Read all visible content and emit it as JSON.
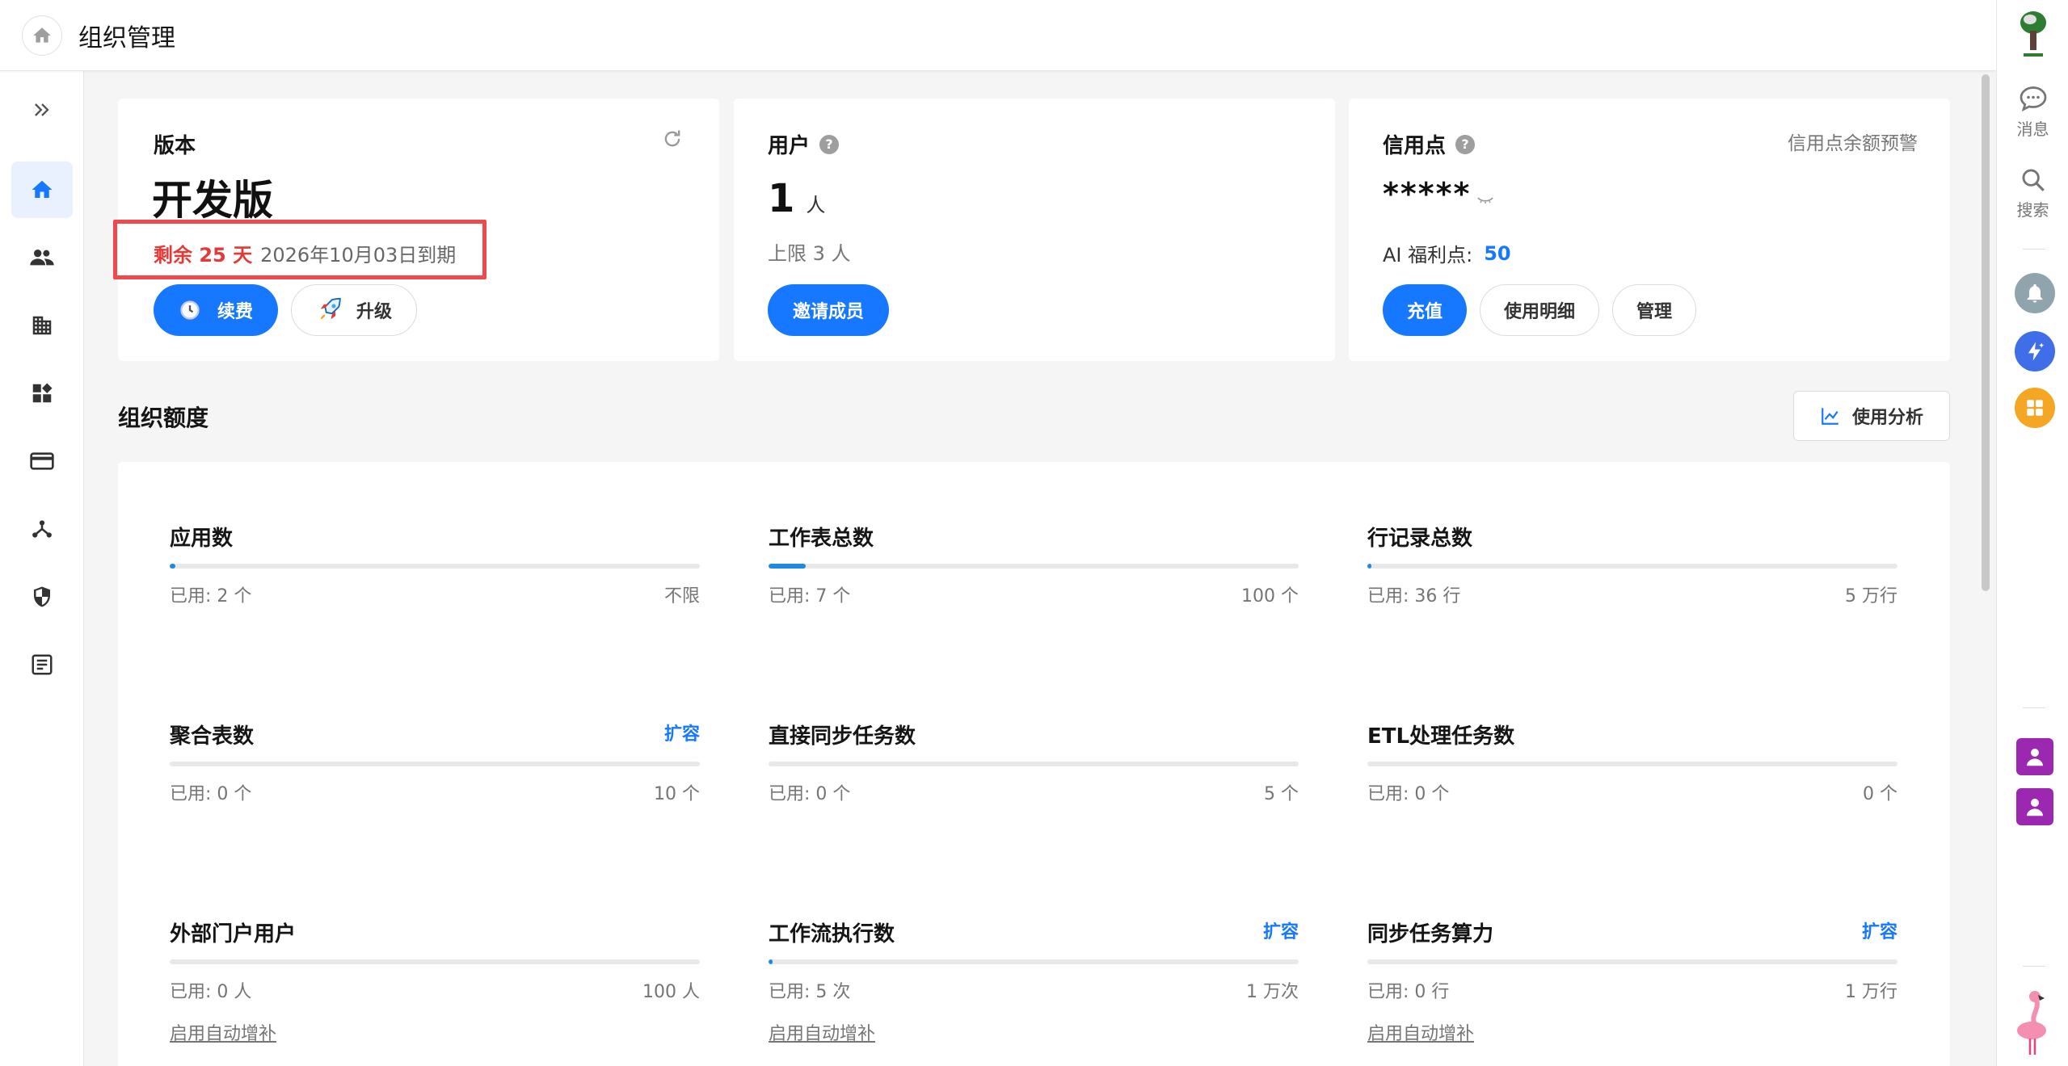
{
  "header": {
    "title": "组织管理"
  },
  "right_rail": {
    "messages_label": "消息",
    "search_label": "搜索"
  },
  "edition": {
    "title": "版本",
    "name": "开发版",
    "remaining": "剩余 25 天",
    "expire": "2026年10月03日到期",
    "renew_label": "续费",
    "upgrade_label": "升级"
  },
  "users": {
    "title": "用户",
    "count": "1",
    "unit": "人",
    "limit": "上限 3 人",
    "invite_label": "邀请成员"
  },
  "credits": {
    "title": "信用点",
    "alert_link": "信用点余额预警",
    "masked_value": "*****",
    "ai_label": "AI 福利点:",
    "ai_value": "50",
    "recharge_label": "充值",
    "details_label": "使用明细",
    "manage_label": "管理"
  },
  "quota_section": {
    "title": "组织额度",
    "analysis_label": "使用分析"
  },
  "quotas": [
    {
      "name": "应用数",
      "used": "已用: 2 个",
      "limit": "不限",
      "expand": "",
      "auto": "",
      "fill": 0.01
    },
    {
      "name": "工作表总数",
      "used": "已用: 7 个",
      "limit": "100 个",
      "expand": "",
      "auto": "",
      "fill": 0.07
    },
    {
      "name": "行记录总数",
      "used": "已用: 36 行",
      "limit": "5 万行",
      "expand": "",
      "auto": "",
      "fill": 0.001
    },
    {
      "name": "聚合表数",
      "used": "已用: 0 个",
      "limit": "10 个",
      "expand": "扩容",
      "auto": "",
      "fill": 0
    },
    {
      "name": "直接同步任务数",
      "used": "已用: 0 个",
      "limit": "5 个",
      "expand": "",
      "auto": "",
      "fill": 0
    },
    {
      "name": "ETL处理任务数",
      "used": "已用: 0 个",
      "limit": "0 个",
      "expand": "",
      "auto": "",
      "fill": 0
    },
    {
      "name": "外部门户用户",
      "used": "已用: 0 人",
      "limit": "100 人",
      "expand": "",
      "auto": "启用自动增补",
      "fill": 0
    },
    {
      "name": "工作流执行数",
      "used": "已用: 5 次",
      "limit": "1 万次",
      "expand": "扩容",
      "auto": "启用自动增补",
      "fill": 0.0005
    },
    {
      "name": "同步任务算力",
      "used": "已用: 0 行",
      "limit": "1 万行",
      "expand": "扩容",
      "auto": "启用自动增补",
      "fill": 0
    }
  ],
  "colors": {
    "accent": "#1677ff",
    "danger": "#e53935",
    "highlight_border": "#f0494d"
  }
}
